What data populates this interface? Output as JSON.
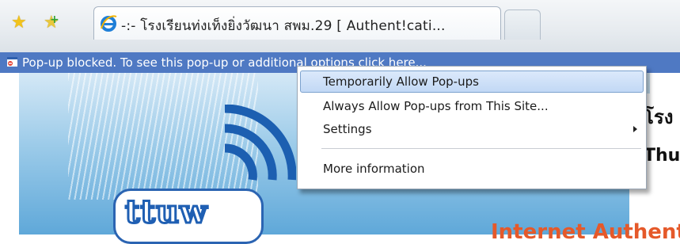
{
  "toolbar": {
    "favorites_icon": "favorites-star-icon",
    "add_favorites_icon": "add-favorites-icon"
  },
  "tabs": [
    {
      "title": "-:- โรงเรียนท่งเท็งยิ่งวัฒนา สพม.29 [ Authent!cati...",
      "icon": "ie-icon",
      "active": true
    },
    {
      "title": "",
      "icon": "new-tab",
      "active": false
    }
  ],
  "infobar": {
    "text": "Pop-up blocked. To see this pop-up or additional options click here...",
    "icon": "popup-blocked-icon",
    "background": "#4f79c3"
  },
  "context_menu": {
    "items": [
      {
        "label": "Temporarily Allow Pop-ups",
        "highlighted": true,
        "submenu": false
      },
      {
        "label": "Always Allow Pop-ups from This Site...",
        "highlighted": false,
        "submenu": false
      },
      {
        "label": "Settings",
        "highlighted": false,
        "submenu": true
      },
      {
        "label": "More information",
        "highlighted": false,
        "submenu": false
      }
    ],
    "highlight_color": "#c8dcf6"
  },
  "page": {
    "logo_text": "ttuw",
    "heading_line1": "โรง",
    "heading_line2": "Thu",
    "banner_text": "Internet Authent",
    "accent_color": "#e5592a"
  }
}
